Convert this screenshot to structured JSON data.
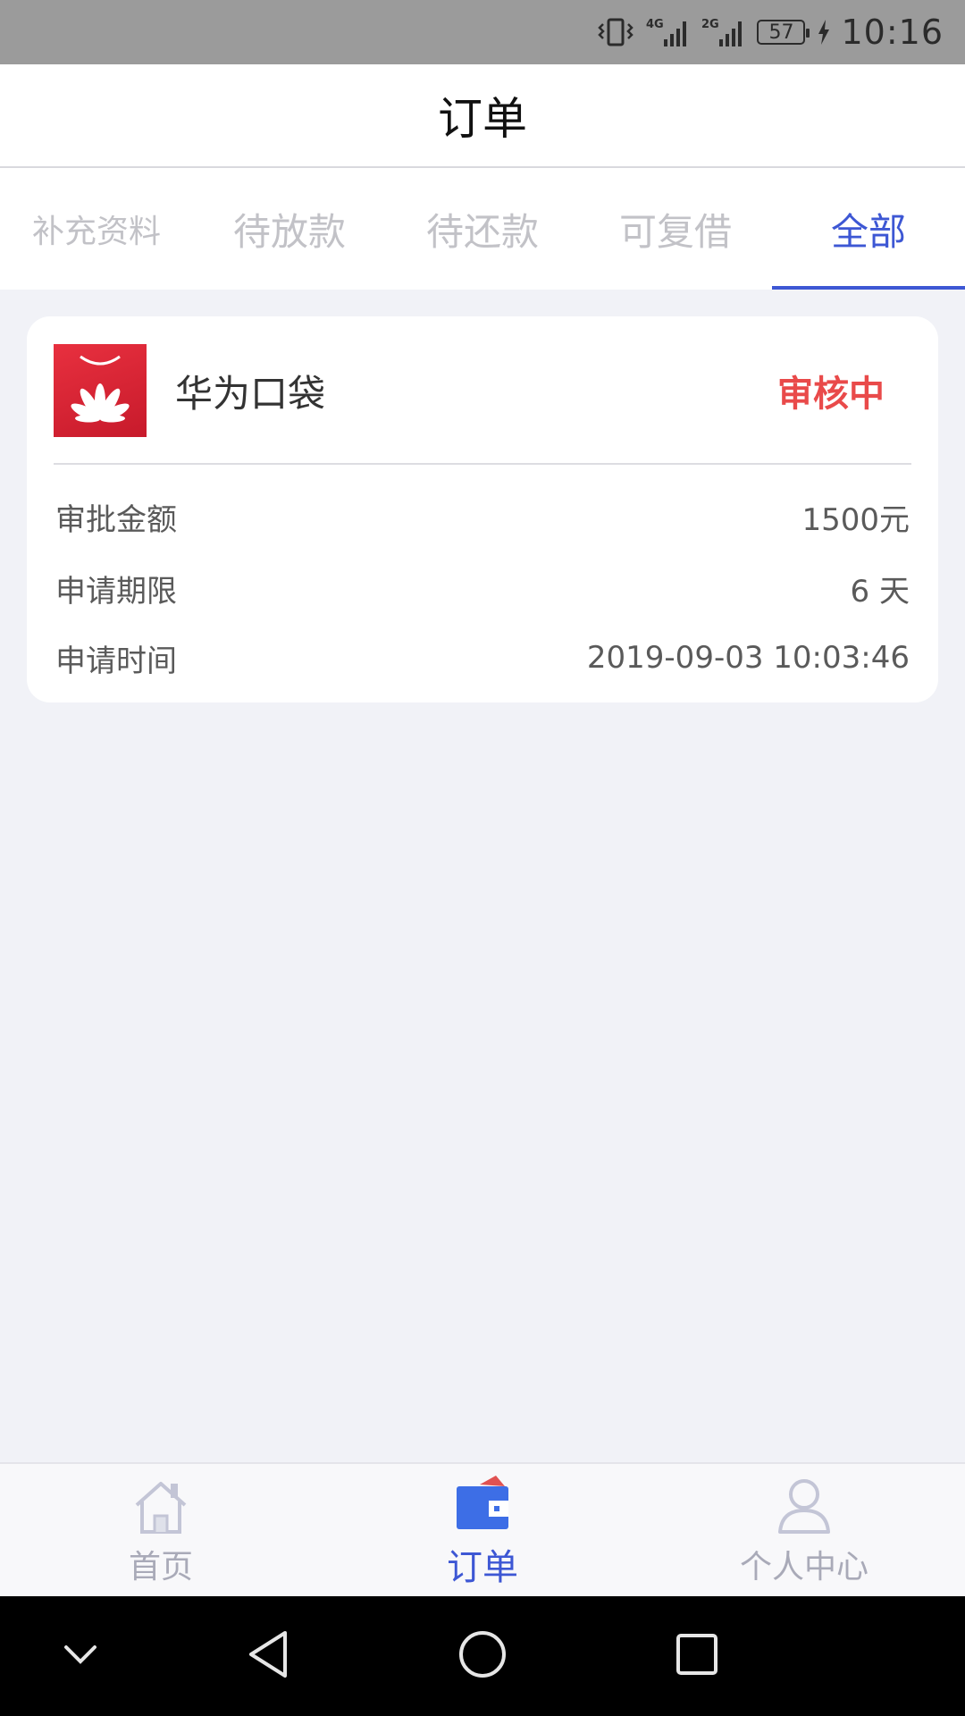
{
  "status_bar": {
    "battery": "57",
    "time": "10:16",
    "network_1": "4G",
    "network_2": "2G"
  },
  "header": {
    "title": "订单"
  },
  "tabs": [
    {
      "label": "补充资料",
      "active": false
    },
    {
      "label": "待放款",
      "active": false
    },
    {
      "label": "待还款",
      "active": false
    },
    {
      "label": "可复借",
      "active": false
    },
    {
      "label": "全部",
      "active": true
    }
  ],
  "order": {
    "logo_icon": "huawei-logo-icon",
    "name": "华为口袋",
    "status": "审核中",
    "rows": [
      {
        "label": "审批金额",
        "value": "1500元"
      },
      {
        "label": "申请期限",
        "value": "6 天"
      },
      {
        "label": "申请时间",
        "value": "2019-09-03 10:03:46"
      }
    ]
  },
  "bottom_nav": [
    {
      "label": "首页",
      "icon": "home-icon",
      "active": false
    },
    {
      "label": "订单",
      "icon": "wallet-icon",
      "active": true
    },
    {
      "label": "个人中心",
      "icon": "user-icon",
      "active": false
    }
  ],
  "colors": {
    "accent": "#3d57d4",
    "status_red": "#e94a4a",
    "background": "#f1f2f7",
    "brand_red": "#d8202f"
  }
}
